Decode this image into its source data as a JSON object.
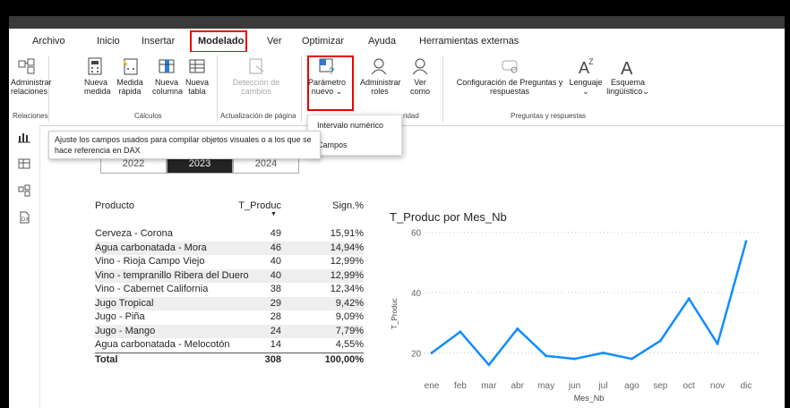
{
  "menu": [
    {
      "label": "Archivo",
      "x": 26
    },
    {
      "label": "Inicio",
      "x": 98
    },
    {
      "label": "Insertar",
      "x": 148
    },
    {
      "label": "Modelado",
      "x": 211,
      "active": true
    },
    {
      "label": "Ver",
      "x": 288
    },
    {
      "label": "Optimizar",
      "x": 327
    },
    {
      "label": "Ayuda",
      "x": 401
    },
    {
      "label": "Herramientas externas",
      "x": 458
    }
  ],
  "ribbon": {
    "administrar_relaciones": "Administrar relaciones",
    "grp_relaciones": "Relaciones",
    "nueva_medida": "Nueva medida",
    "medida_rapida": "Medida rápida",
    "nueva_columna": "Nueva columna",
    "nueva_tabla": "Nueva tabla",
    "grp_calculos": "Cálculos",
    "deteccion_cambios": "Detección de cambios",
    "grp_actualizacion": "Actualización de página",
    "parametro_nuevo": "Parámetro nuevo",
    "administrar_roles": "Administrar roles",
    "ver_como": "Ver como",
    "grp_seguridad_partial": "ridad",
    "config_preguntas": "Configuración de Preguntas y respuestas",
    "lenguaje": "Lenguaje",
    "esquema_linguistico": "Esquema lingüístico",
    "grp_preguntas": "Preguntas y respuestas"
  },
  "dropdown": {
    "intervalo": "Intervalo numérico",
    "campos": "Campos"
  },
  "tooltip": "Ajuste los campos usados para compilar objetos visuales o a los que se hace referencia en DAX",
  "slicer": [
    {
      "label": "2022",
      "selected": false
    },
    {
      "label": "2023",
      "selected": true
    },
    {
      "label": "2024",
      "selected": false
    }
  ],
  "table": {
    "headers": [
      "Producto",
      "T_Produc",
      "Sign.%"
    ],
    "rows": [
      [
        "Cerveza - Corona",
        "49",
        "15,91%"
      ],
      [
        "Agua carbonatada - Mora",
        "46",
        "14,94%"
      ],
      [
        "Vino - Rioja Campo Viejo",
        "40",
        "12,99%"
      ],
      [
        "Vino - tempranillo Ribera del Duero",
        "40",
        "12,99%"
      ],
      [
        "Vino - Cabernet California",
        "38",
        "12,34%"
      ],
      [
        "Jugo Tropical",
        "29",
        "9,42%"
      ],
      [
        "Jugo - Piña",
        "28",
        "9,09%"
      ],
      [
        "Jugo - Mango",
        "24",
        "7,79%"
      ],
      [
        "Agua carbonatada - Melocotón",
        "14",
        "4,55%"
      ]
    ],
    "total": [
      "Total",
      "308",
      "100,00%"
    ]
  },
  "chart_data": {
    "type": "line",
    "title": "T_Produc por Mes_Nb",
    "xlabel": "Mes_Nb",
    "ylabel": "T_Produc",
    "categories": [
      "ene",
      "feb",
      "mar",
      "abr",
      "may",
      "jun",
      "jul",
      "ago",
      "sep",
      "oct",
      "nov",
      "dic"
    ],
    "values": [
      20,
      27,
      16,
      28,
      19,
      18,
      20,
      18,
      24,
      38,
      23,
      57
    ],
    "yticks": [
      20,
      40,
      60
    ],
    "ylim": [
      10,
      62
    ],
    "color": "#118DFF",
    "grid": true
  },
  "colors": {
    "accent": "#118DFF",
    "highlight": "#e00000",
    "selected": "#252423"
  }
}
